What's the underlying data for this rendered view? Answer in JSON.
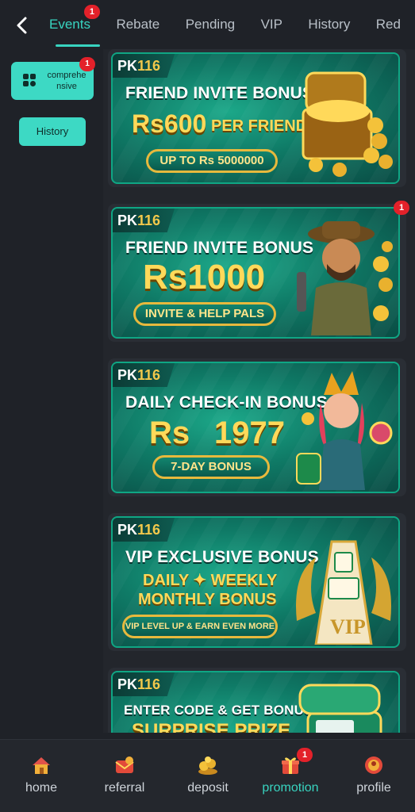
{
  "header": {
    "tabs": [
      {
        "label": "Events",
        "badge": "1",
        "active": true
      },
      {
        "label": "Rebate"
      },
      {
        "label": "Pending"
      },
      {
        "label": "VIP"
      },
      {
        "label": "History"
      },
      {
        "label": "Red"
      }
    ]
  },
  "sidebar": {
    "category_label": "comprehe nsive",
    "category_badge": "1",
    "history_label": "History"
  },
  "promos": [
    {
      "logo_a": "PK",
      "logo_b": "116",
      "title": "FRIEND INVITE BONUS",
      "amount": "Rs600",
      "amount_suffix": "PER FRIEND",
      "button": "UP TO Rs 5000000",
      "art": "treasure-chest-gold-coins"
    },
    {
      "logo_a": "PK",
      "logo_b": "116",
      "title": "FRIEND INVITE BONUS",
      "amount": "Rs1000",
      "button": "INVITE & HELP PALS",
      "badge": "1",
      "art": "explorer-character-coins"
    },
    {
      "logo_a": "PK",
      "logo_b": "116",
      "title": "DAILY CHECK-IN BONUS",
      "amount": "Rs",
      "amount_value": "1977",
      "button": "7-DAY BONUS",
      "art": "jester-girl-character"
    },
    {
      "logo_a": "PK",
      "logo_b": "116",
      "title": "VIP EXCLUSIVE BONUS",
      "line2": "DAILY ✦ WEEKLY",
      "line3": "MONTHLY BONUS",
      "button": "VIP LEVEL UP & EARN EVEN MORE",
      "art": "vip-mahjong-tower-dragons"
    },
    {
      "logo_a": "PK",
      "logo_b": "116",
      "title": "ENTER CODE & GET BONUS!",
      "amount": "SURPRISE PRIZE",
      "art": "code-bonus-chest"
    }
  ],
  "bottom_nav": [
    {
      "label": "home",
      "icon": "house-icon"
    },
    {
      "label": "referral",
      "icon": "gift-envelope-icon"
    },
    {
      "label": "deposit",
      "icon": "coin-pile-icon"
    },
    {
      "label": "promotion",
      "icon": "gift-box-icon",
      "badge": "1",
      "active": true
    },
    {
      "label": "profile",
      "icon": "profile-orb-icon"
    }
  ],
  "colors": {
    "accent": "#38d4c0",
    "badge": "#e3212a",
    "gold": "#ffd95a",
    "banner": "#0f7a66"
  }
}
